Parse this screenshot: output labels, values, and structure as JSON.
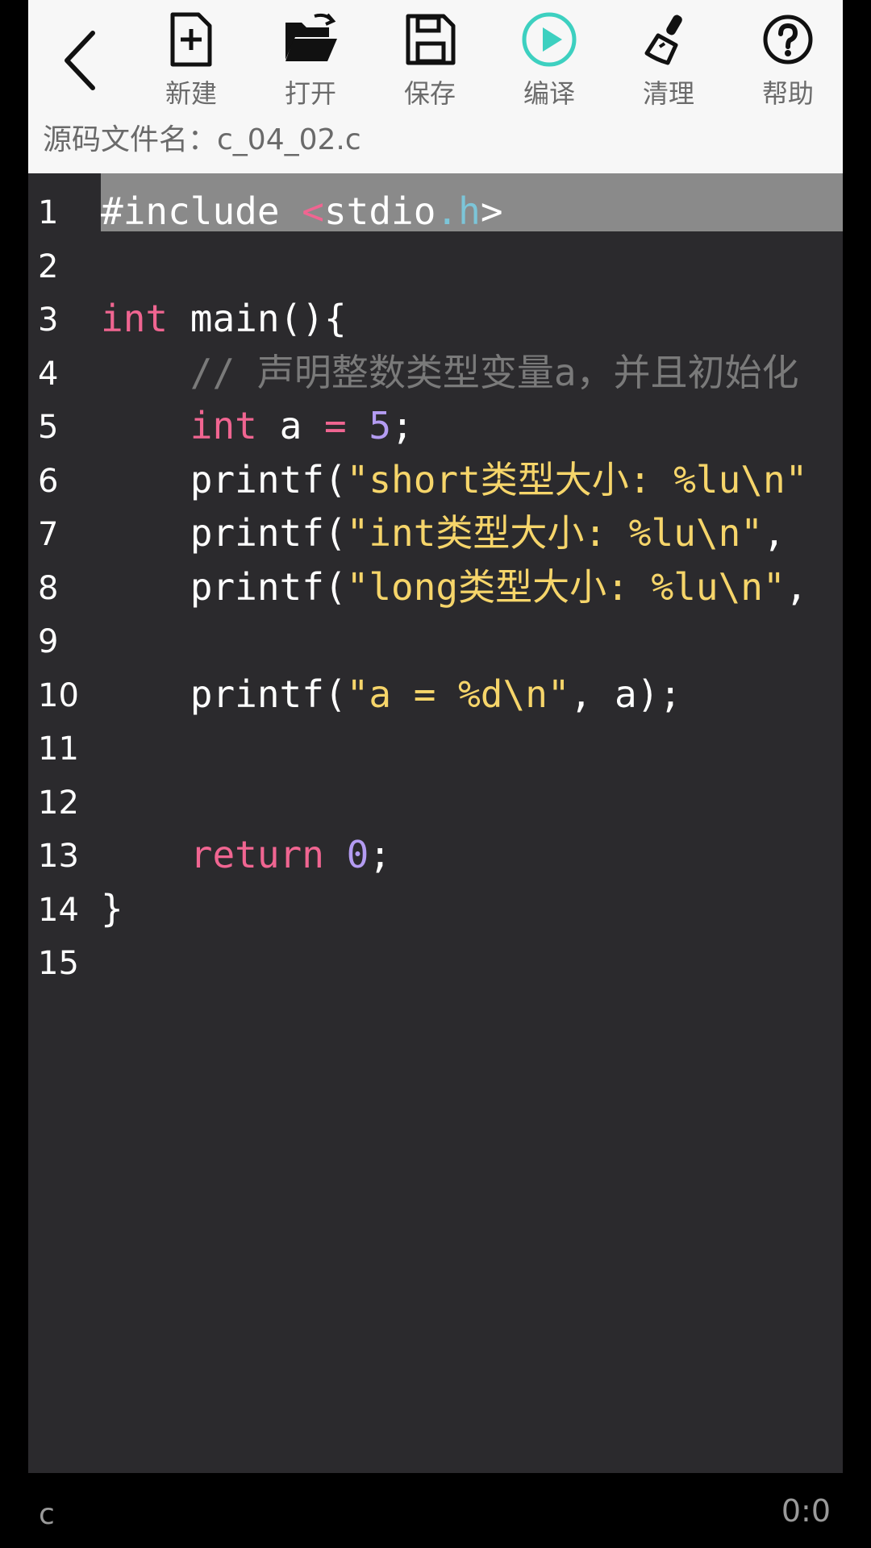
{
  "toolbar": {
    "new_label": "新建",
    "open_label": "打开",
    "save_label": "保存",
    "compile_label": "编译",
    "clean_label": "清理",
    "help_label": "帮助"
  },
  "file": {
    "name_label": "源码文件名：",
    "name": "c_04_02.c"
  },
  "colors": {
    "accent": "#3dd0c0",
    "keyword": "#f06591",
    "string": "#f6d56a",
    "number": "#b49cf2",
    "comment": "#7a7a7a",
    "header": "#7cc5d8"
  },
  "editor": {
    "lines": [
      {
        "n": "1",
        "tokens": [
          [
            "",
            "#include "
          ],
          [
            "kw",
            "<"
          ],
          [
            "",
            "stdio"
          ],
          [
            "hdr",
            ".h"
          ],
          [
            "",
            ">"
          ]
        ]
      },
      {
        "n": "2",
        "tokens": []
      },
      {
        "n": "3",
        "tokens": [
          [
            "kw",
            "int"
          ],
          [
            "",
            " main(){"
          ]
        ]
      },
      {
        "n": "4",
        "tokens": [
          [
            "",
            "    "
          ],
          [
            "cm",
            "// 声明整数类型变量a，并且初始化"
          ]
        ]
      },
      {
        "n": "5",
        "tokens": [
          [
            "",
            "    "
          ],
          [
            "kw",
            "int"
          ],
          [
            "",
            " a "
          ],
          [
            "kw",
            "="
          ],
          [
            "",
            " "
          ],
          [
            "num",
            "5"
          ],
          [
            "",
            ";"
          ]
        ]
      },
      {
        "n": "6",
        "tokens": [
          [
            "",
            "    printf("
          ],
          [
            "str",
            "\"short类型大小: %lu\\n\""
          ]
        ]
      },
      {
        "n": "7",
        "tokens": [
          [
            "",
            "    printf("
          ],
          [
            "str",
            "\"int类型大小: %lu\\n\""
          ],
          [
            "",
            ", "
          ]
        ]
      },
      {
        "n": "8",
        "tokens": [
          [
            "",
            "    printf("
          ],
          [
            "str",
            "\"long类型大小: %lu\\n\""
          ],
          [
            "",
            ","
          ]
        ]
      },
      {
        "n": "9",
        "tokens": []
      },
      {
        "n": "10",
        "tokens": [
          [
            "",
            "    printf("
          ],
          [
            "str",
            "\"a = %d\\n\""
          ],
          [
            "",
            ", a);"
          ]
        ]
      },
      {
        "n": "11",
        "tokens": []
      },
      {
        "n": "12",
        "tokens": []
      },
      {
        "n": "13",
        "tokens": [
          [
            "",
            "    "
          ],
          [
            "kw",
            "return"
          ],
          [
            "",
            " "
          ],
          [
            "num",
            "0"
          ],
          [
            "",
            ";"
          ]
        ]
      },
      {
        "n": "14",
        "tokens": [
          [
            "",
            "}"
          ]
        ]
      },
      {
        "n": "15",
        "tokens": []
      }
    ]
  },
  "status": {
    "language": "c",
    "cursor": "0:0"
  }
}
